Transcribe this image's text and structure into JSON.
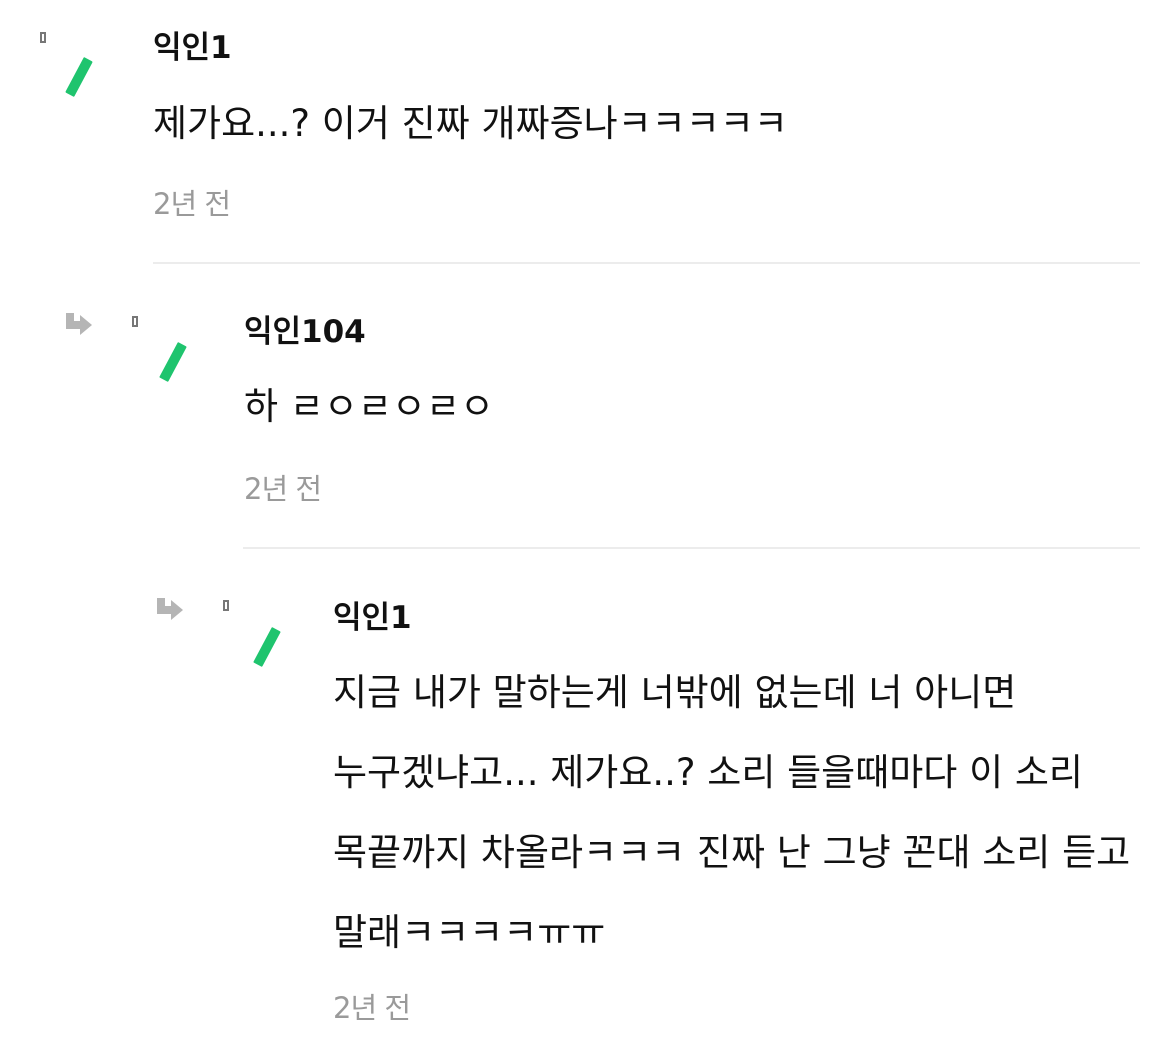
{
  "comments": [
    {
      "author": "익인1",
      "body": "제가요...? 이거 진짜 개짜증나ㅋㅋㅋㅋㅋ",
      "time": "2년 전",
      "is_reply": false
    },
    {
      "author": "익인104",
      "body": "하 ㄹㅇㄹㅇㄹㅇ",
      "time": "2년 전",
      "is_reply": true
    },
    {
      "author": "익인1",
      "body": "지금 내가 말하는게 너밖에 없는데 너 아니면 누구겠냐고... 제가요..? 소리 들을때마다 이 소리 목끝까지 차올라ㅋㅋㅋ 진짜 난 그냥 꼰대 소리 듣고 말래ㅋㅋㅋㅋㅠㅠ",
      "time": "2년 전",
      "is_reply": true
    }
  ],
  "icons": {
    "avatar": "green-leaf-icon",
    "reply": "reply-arrow-icon",
    "marker": "broken-image-icon"
  },
  "colors": {
    "accent": "#1fc46e",
    "meta_text": "#9a9a9a",
    "divider": "#ececec",
    "reply_arrow": "#b5b5b5"
  }
}
